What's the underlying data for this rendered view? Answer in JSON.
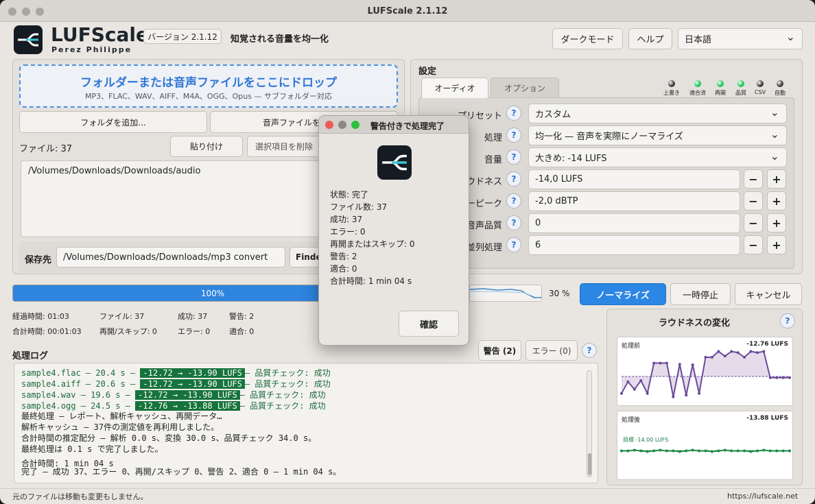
{
  "window": {
    "title": "LUFScale 2.1.12"
  },
  "header": {
    "app_name": "LUFScale",
    "author": "Perez Philippe",
    "version": "バージョン 2.1.12",
    "tagline": "知覚される音量を均一化",
    "dark_mode": "ダークモード",
    "help": "ヘルプ",
    "language": "日本語"
  },
  "drop": {
    "title": "フォルダーまたは音声ファイルをここにドロップ",
    "subtitle": "MP3、FLAC、WAV、AIFF、M4A、OGG、Opus — サブフォルダー対応"
  },
  "files": {
    "add_folder": "フォルダを追加...",
    "add_files": "音声ファイルを",
    "count_label": "ファイル: 37",
    "paste": "貼り付け",
    "remove_selected": "選択項目を削除",
    "list": [
      "/Volumes/Downloads/Downloads/audio"
    ],
    "save_label": "保存先",
    "save_path": "/Volumes/Downloads/Downloads/mp3 convert",
    "finder": "Finde"
  },
  "settings": {
    "title": "設定",
    "tabs": [
      "オーディオ",
      "オプション"
    ],
    "indicators": [
      {
        "label": "上書き",
        "color": "#3a3a3a"
      },
      {
        "label": "適合済",
        "color": "#1fc65a"
      },
      {
        "label": "再開",
        "color": "#1fc65a"
      },
      {
        "label": "品質",
        "color": "#1fc65a"
      },
      {
        "label": "CSV",
        "color": "#3a3a3a"
      },
      {
        "label": "自動",
        "color": "#3a3a3a"
      }
    ],
    "rows": [
      {
        "label": "プリセット",
        "value": "カスタム"
      },
      {
        "label": "処理",
        "value": "均一化 — 音声を実際にノーマライズ"
      },
      {
        "label": "音量",
        "value": "大きめ: -14 LUFS"
      },
      {
        "label": "ウドネス",
        "value": "-14,0 LUFS"
      },
      {
        "label": "ーピーク",
        "value": "-2,0 dBTP"
      },
      {
        "label": "音声品質",
        "value": "0"
      },
      {
        "label": "並列処理",
        "value": "6"
      }
    ]
  },
  "progress": {
    "percent_label": "100%",
    "value": 1.0,
    "mini_label": "30 %",
    "normalize": "ノーマライズ",
    "pause": "一時停止",
    "cancel": "キャンセル"
  },
  "stats": {
    "row1": [
      "経過時間: 01:03",
      "ファイル: 37",
      "成功: 37",
      "警告: 2"
    ],
    "row2": [
      "合計時間: 00:01:03",
      "再開/スキップ: 0",
      "エラー: 0",
      "適合: 0"
    ]
  },
  "log": {
    "title": "処理ログ",
    "warnings_btn": "警告 (2)",
    "errors_btn": "エラー (0)",
    "entries": [
      {
        "pre": "sample4.flac — 20.4 s — ",
        "bar": "-12.72 → -13.90 LUFS",
        "post": "— 品質チェック: 成功"
      },
      {
        "pre": "sample4.aiff — 20.6 s — ",
        "bar": "-12.72 → -13.90 LUFS",
        "post": "— 品質チェック: 成功"
      },
      {
        "pre": "sample4.wav — 19.6 s — ",
        "bar": "-12.72 → -13.90 LUFS",
        "post": "— 品質チェック: 成功"
      },
      {
        "pre": "sample4.ogg — 24.5 s — ",
        "bar": "-12.76 → -13.88 LUFS",
        "post": "— 品質チェック: 成功"
      }
    ],
    "lines": [
      "最終処理 — レポート、解析キャッシュ、再開データ…",
      "解析キャッシュ — 37件の測定値を再利用しました。",
      "合計時間の推定配分 — 解析 0.0 s、変換 30.0 s、品質チェック 34.0 s。",
      "最終処理は 0.1 s で完了しました。",
      "合計時間: 1 min 04 s",
      "完了 — 成功 37、エラー 0、再開/スキップ 0、警告 2、適合 0 — 1 min 04 s。"
    ]
  },
  "loudness": {
    "title": "ラウドネスの変化",
    "before_label": "処理前",
    "before_value": "-12.76 LUFS",
    "after_label": "処理後",
    "after_value": "-13.88 LUFS",
    "target_label": "目標 -14.00 LUFS",
    "before_series": [
      0.82,
      0.62,
      0.75,
      0.6,
      0.82,
      0.3,
      0.3,
      0.3,
      0.88,
      0.32,
      0.85,
      0.33,
      0.82,
      0.2,
      0.2,
      0.1,
      0.18,
      0.1,
      0.12,
      0.2,
      0.1,
      0.12,
      0.1,
      0.55,
      0.55,
      0.55,
      0.55
    ],
    "after_series": [
      0.5,
      0.5,
      0.49,
      0.5,
      0.51,
      0.5,
      0.49,
      0.5,
      0.5,
      0.51,
      0.5,
      0.49,
      0.5,
      0.5,
      0.51,
      0.5,
      0.49,
      0.5,
      0.5,
      0.5,
      0.51,
      0.5,
      0.49,
      0.5,
      0.5,
      0.5,
      0.5
    ]
  },
  "dialog": {
    "title": "警告付きで処理完了",
    "lines": [
      "状態: 完了",
      "ファイル数: 37",
      "成功: 37",
      "エラー: 0",
      "再開またはスキップ: 0",
      "警告: 2",
      "適合: 0",
      "合計時間: 1 min 04 s"
    ],
    "ok": "確認"
  },
  "footer": {
    "note": "元のファイルは移動も変更もしません。",
    "url": "https://lufscale.net"
  }
}
